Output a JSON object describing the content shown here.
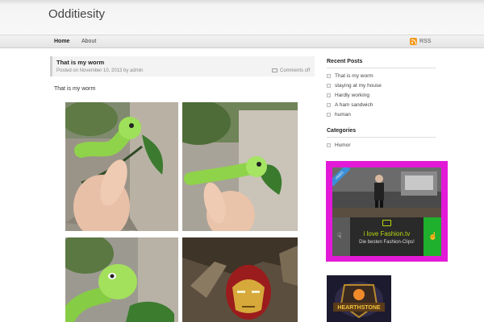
{
  "site": {
    "title": "Odditiesity"
  },
  "nav": {
    "items": [
      "Home",
      "About"
    ],
    "rss_label": "RSS"
  },
  "post": {
    "title": "That is my worm",
    "meta": "Posted on November 10, 2013 by admin",
    "comments": "Comments off",
    "body": "That is my worm"
  },
  "sidebar": {
    "recent_heading": "Recent Posts",
    "recent": [
      "That is my worm",
      "staying at my house",
      "Hardly working",
      "A ham sandwich",
      "human"
    ],
    "categories_heading": "Categories",
    "categories": [
      "Humor"
    ]
  },
  "ad": {
    "badge": "VIDEO",
    "brand": "i love Fashion.tv",
    "tagline": "Die besten Fashion-Clips!"
  },
  "game": {
    "brand": "HEARTHSTONE"
  },
  "colors": {
    "ad_border": "#e21ad7",
    "rss": "#f39a1e",
    "like": "#1fb02d"
  }
}
